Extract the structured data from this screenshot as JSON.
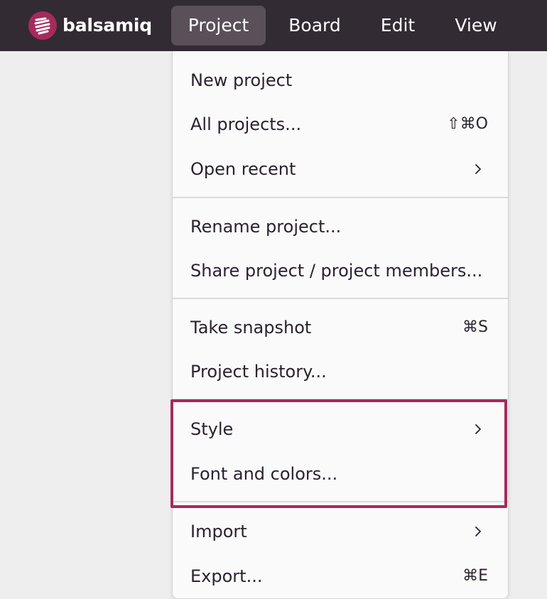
{
  "app": {
    "name": "balsamiq",
    "accent_color": "#a52a5d",
    "topbar_color": "#332b33"
  },
  "menubar": [
    {
      "label": "Project",
      "active": true
    },
    {
      "label": "Board",
      "active": false
    },
    {
      "label": "Edit",
      "active": false
    },
    {
      "label": "View",
      "active": false
    }
  ],
  "project_menu": {
    "items": [
      {
        "label": "New project",
        "shortcut": ""
      },
      {
        "label": "All projects...",
        "shortcut": "⇧⌘O"
      },
      {
        "label": "Open recent",
        "submenu": true
      },
      {
        "label": "Rename project...",
        "shortcut": ""
      },
      {
        "label": "Share project / project members...",
        "shortcut": ""
      },
      {
        "label": "Take snapshot",
        "shortcut": "⌘S"
      },
      {
        "label": "Project history...",
        "shortcut": ""
      },
      {
        "label": "Style",
        "submenu": true
      },
      {
        "label": "Font and colors...",
        "shortcut": ""
      },
      {
        "label": "Import",
        "submenu": true
      },
      {
        "label": "Export...",
        "shortcut": "⌘E"
      }
    ]
  },
  "icons": {
    "logo": "balsamiq-logo-icon",
    "submenu": "chevron-right-icon"
  }
}
